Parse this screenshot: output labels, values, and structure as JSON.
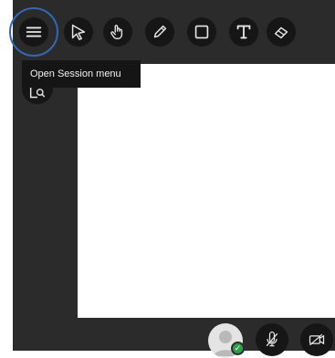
{
  "toolbar": {
    "tools": [
      {
        "name": "menu-icon"
      },
      {
        "name": "select-arrow-icon"
      },
      {
        "name": "pan-hand-icon"
      },
      {
        "name": "pencil-icon"
      },
      {
        "name": "rectangle-icon"
      },
      {
        "name": "text-icon"
      },
      {
        "name": "eraser-icon"
      }
    ]
  },
  "tooltip": {
    "text": "Open Session menu"
  },
  "colors": {
    "frame": "#2b2b2b",
    "button": "#161616",
    "highlight_ring": "#3567b8",
    "status_green": "#2f9e48"
  },
  "bottom_bar": {
    "icons": [
      "user-avatar",
      "status-check-icon",
      "microphone-muted-icon",
      "camera-off-icon"
    ]
  }
}
